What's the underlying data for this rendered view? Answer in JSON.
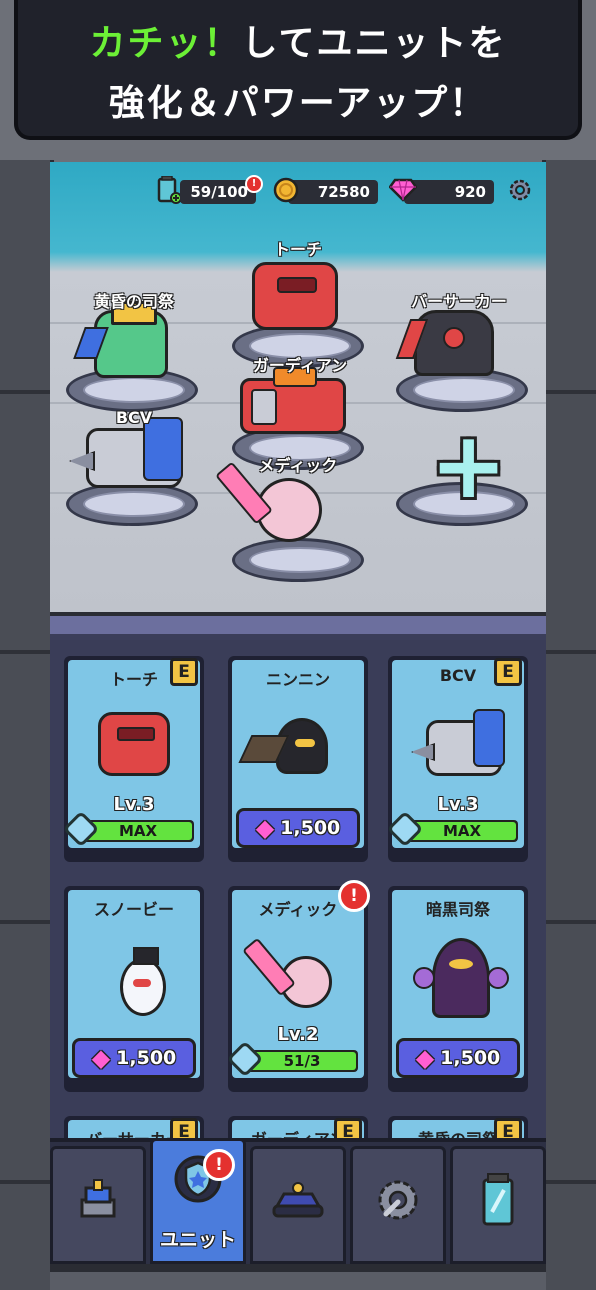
{
  "banner": {
    "line1_highlight": "カチッ！",
    "line1_rest": "してユニットを",
    "line2": "強化＆パワーアップ！"
  },
  "hud": {
    "energy": "59/100",
    "coins": "72580",
    "gems": "920",
    "energy_badge": "!"
  },
  "squad": {
    "units": [
      {
        "name": "黄昏の司祭"
      },
      {
        "name": "トーチ"
      },
      {
        "name": "バーサーカー"
      },
      {
        "name": "ガーディアン"
      },
      {
        "name": "BCV"
      },
      {
        "name": "メディック"
      }
    ],
    "add_slot_icon": "plus-icon"
  },
  "cards": [
    {
      "name": "トーチ",
      "grade": "E",
      "level": "Lv.3",
      "progress_label": "MAX",
      "progress": 1.0
    },
    {
      "name": "ニンニン",
      "price": "1,500"
    },
    {
      "name": "BCV",
      "grade": "E",
      "level": "Lv.3",
      "progress_label": "MAX",
      "progress": 1.0
    },
    {
      "name": "スノービー",
      "price": "1,500"
    },
    {
      "name": "メディック",
      "level": "Lv.2",
      "progress_label": "51/3",
      "progress": 1.0,
      "alert": "!"
    },
    {
      "name": "暗黒司祭",
      "price": "1,500"
    },
    {
      "name": "バーサーカー",
      "grade": "E"
    },
    {
      "name": "ガーディアン",
      "grade": "E"
    },
    {
      "name": "黄昏の司祭",
      "grade": "E"
    }
  ],
  "nav": {
    "tabs": [
      {
        "icon": "base-icon"
      },
      {
        "icon": "unit-shield-icon",
        "label": "ユニット",
        "alert": "!"
      },
      {
        "icon": "vehicle-icon"
      },
      {
        "icon": "gear-wrench-icon"
      },
      {
        "icon": "energy-tank-icon"
      }
    ]
  },
  "colors": {
    "highlight": "#6cf036",
    "progress_fill": "#63e33f",
    "gem": "#ff5fd2",
    "active_tab": "#4b7cdc",
    "grade_badge": "#f2c444",
    "alert": "#e4312f"
  }
}
